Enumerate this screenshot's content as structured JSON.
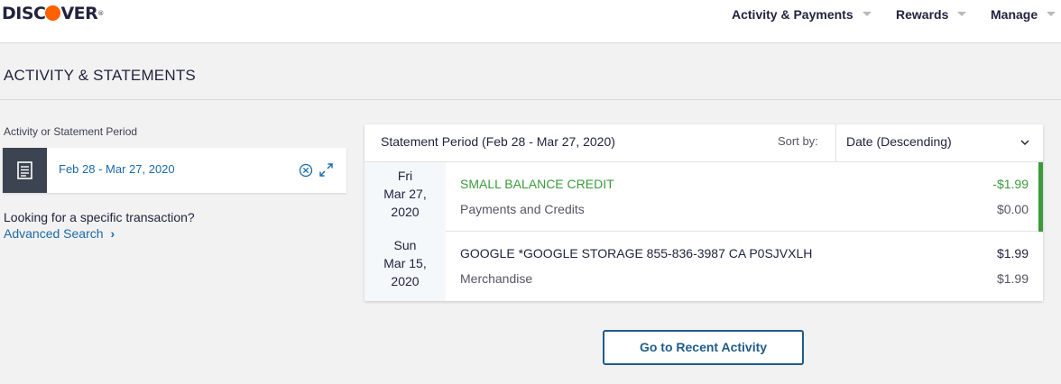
{
  "brand": {
    "logo_left": "DISC",
    "logo_right": "VER",
    "logo_mark": "®",
    "accent": "#ff6000"
  },
  "nav": {
    "items": [
      {
        "label": "Activity & Payments"
      },
      {
        "label": "Rewards"
      },
      {
        "label": "Manage"
      }
    ]
  },
  "page": {
    "title": "ACTIVITY & STATEMENTS"
  },
  "period_picker": {
    "label": "Activity or Statement Period",
    "value": "Feb 28 - Mar 27, 2020",
    "icon": "statement-document-icon"
  },
  "search_help": {
    "prompt": "Looking for a specific transaction?",
    "link_label": "Advanced Search",
    "link_chevron": "›"
  },
  "statement": {
    "period_label": "Statement Period (Feb 28 - Mar 27, 2020)",
    "sort_label": "Sort by:",
    "sort_value": "Date (Descending)"
  },
  "transactions": [
    {
      "day": "Fri",
      "date": "Mar 27,",
      "year": "2020",
      "description": "SMALL BALANCE CREDIT",
      "category": "Payments and Credits",
      "amount": "-$1.99",
      "secondary_amount": "$0.00",
      "status_color": "#3a9a3a"
    },
    {
      "day": "Sun",
      "date": "Mar 15,",
      "year": "2020",
      "description": "GOOGLE *GOOGLE STORAGE 855-836-3987 CA P0SJVXLH",
      "category": "Merchandise",
      "amount": "$1.99",
      "secondary_amount": "$1.99"
    }
  ],
  "actions": {
    "recent_activity": "Go to Recent Activity"
  },
  "colors": {
    "link": "#1b6aa8",
    "button": "#1f5c8a",
    "credit": "#3a9a3a",
    "icon_box": "#3c4452"
  }
}
